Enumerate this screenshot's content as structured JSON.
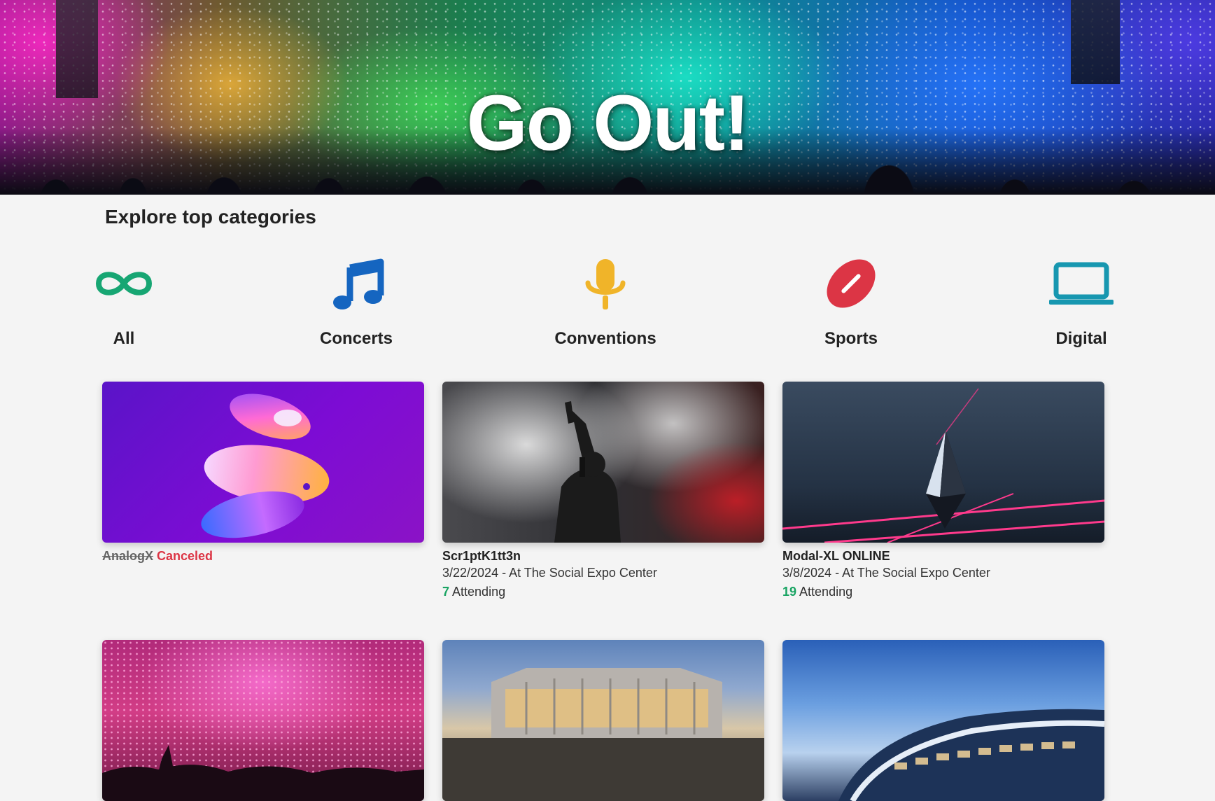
{
  "hero": {
    "title": "Go Out!"
  },
  "categories_section": {
    "title": "Explore top categories",
    "items": [
      {
        "label": "All",
        "icon": "infinity-icon",
        "color": "#17a673"
      },
      {
        "label": "Concerts",
        "icon": "music-note-icon",
        "color": "#1565c0"
      },
      {
        "label": "Conventions",
        "icon": "microphone-icon",
        "color": "#f0b429"
      },
      {
        "label": "Sports",
        "icon": "football-icon",
        "color": "#dc3545"
      },
      {
        "label": "Digital",
        "icon": "laptop-icon",
        "color": "#1797b0"
      }
    ]
  },
  "events": [
    {
      "name": "AnalogX",
      "status": "Canceled",
      "canceled": true,
      "image": "abstract-3d-shapes"
    },
    {
      "name": "Scr1ptK1tt3n",
      "date": "3/22/2024",
      "location_text": " - At The Social Expo Center",
      "attending_count": "7",
      "attending_label": " Attending",
      "image": "singer-on-stage"
    },
    {
      "name": "Modal-XL ONLINE",
      "date": "3/8/2024",
      "location_text": " - At The Social Expo Center",
      "attending_count": "19",
      "attending_label": " Attending",
      "image": "crystal-render"
    },
    {
      "name": "",
      "image": "confetti-crowd"
    },
    {
      "name": "",
      "image": "arena-exterior"
    },
    {
      "name": "",
      "image": "stadium-exterior"
    }
  ],
  "colors": {
    "background": "#f4f4f4",
    "canceled": "#dc3545",
    "attending": "#19a463"
  }
}
